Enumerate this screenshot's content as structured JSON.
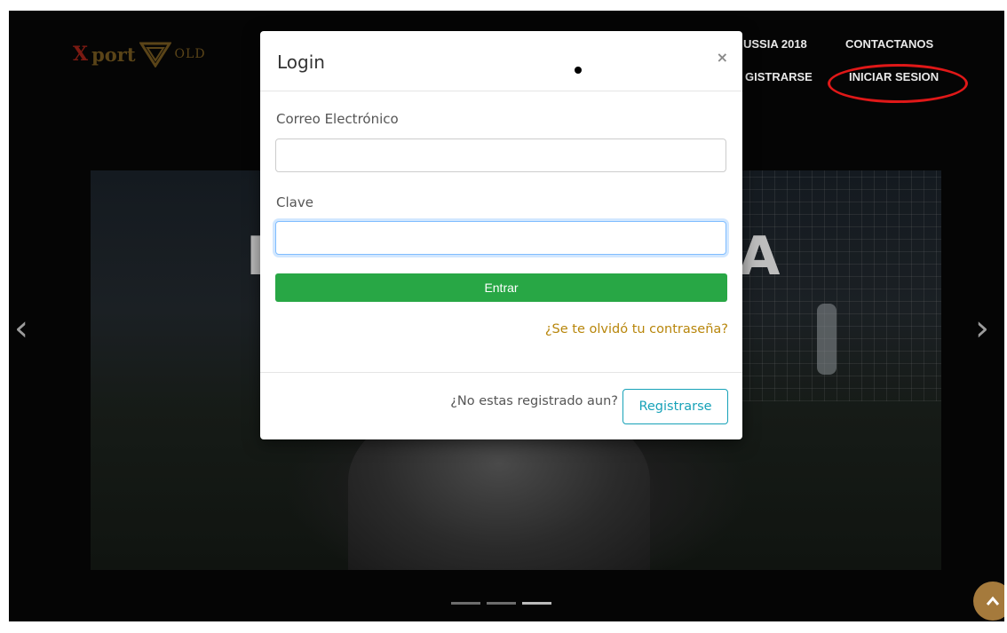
{
  "brand": {
    "prefix": "X",
    "word": "port",
    "suffix": "OLD"
  },
  "nav": {
    "russia": "USSIA 2018",
    "contact": "CONTACTANOS",
    "register": "GISTRARSE",
    "login": "INICIAR SESION"
  },
  "hero": {
    "left_text": "I",
    "right_text": "A"
  },
  "carousel": {
    "prev": "‹",
    "next": "›",
    "slides": 3,
    "active_index": 2
  },
  "modal": {
    "title": "Login",
    "close": "×",
    "email_label": "Correo Electrónico",
    "email_value": "",
    "password_label": "Clave",
    "password_value": "",
    "submit_label": "Entrar",
    "forgot_link": "¿Se te olvidó tu contraseña?",
    "footer_text": "¿No estas registrado aun?",
    "register_label": "Registrarse"
  },
  "scroll_top": "^",
  "colors": {
    "submit": "#28a745",
    "link": "#b8860b",
    "register_border": "#17a2b8",
    "annotation": "#e01818",
    "scroll_top": "#a57a3c"
  }
}
